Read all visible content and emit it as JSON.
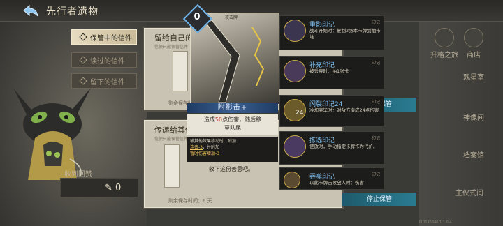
{
  "header": {
    "title": "先行者遗物"
  },
  "tabs": [
    {
      "label": "保管中的信件",
      "active": true
    },
    {
      "label": "读过的信件",
      "active": false
    },
    {
      "label": "留下的信件",
      "active": false
    }
  ],
  "received": {
    "label": "收到回赞",
    "count": "0"
  },
  "letters": [
    {
      "title": "留给自己的",
      "subtitle": "信使只能保管信件",
      "remain": "剩余保存时间："
    },
    {
      "title": "传递给其他",
      "subtitle": "信使只能保管信件",
      "note": "收下这份善意吧。",
      "remain": "剩余保存时间：6 天"
    }
  ],
  "card": {
    "cost": "0",
    "type": "攻击牌",
    "name": "附影击+",
    "desc_line1_pre": "造成",
    "desc_damage": "50",
    "desc_line1_post": "点伤害，随后移",
    "desc_line2": "至队尾",
    "tip_line1": "被其他效果移动时：附加",
    "tip_line2_hl": "连击-3",
    "tip_line2_post": "，并附加",
    "tip_line3_hl": "暂时伤害增加-3"
  },
  "seals": [
    {
      "title": "重影印记",
      "tag": "印记",
      "desc": "战斗开始时：复制2张本卡牌到抽卡堆"
    },
    {
      "title": "补充印记",
      "tag": "印记",
      "desc": "被丢弃时：抽1张卡"
    },
    {
      "title": "闪裂印记24",
      "tag": "印记",
      "desc": "冷却完毕时：对敌方造成24点伤害",
      "badge": "24"
    },
    {
      "title": "拣选印记",
      "tag": "印记",
      "desc": "使放时，手动指定卡牌作为代价。"
    },
    {
      "title": "吞噬印记",
      "tag": "印记",
      "desc": "以此卡牌击败敌人时：伤害"
    }
  ],
  "buttons": {
    "stop_keep_1": "停止保管",
    "stop_keep_2": "停止保管"
  },
  "sidebar": [
    {
      "label": "升格之旅"
    },
    {
      "label": "商店"
    },
    {
      "label": "观星室"
    },
    {
      "label": "神像间"
    },
    {
      "label": "档案馆"
    },
    {
      "label": "主仪式间"
    }
  ],
  "footer": {
    "version": "PID145846 1.1.0.4"
  },
  "colors": {
    "accent_blue": "#6fb3e8",
    "button_teal": "#2a7b91",
    "seal_title": "#7ec1f2"
  }
}
